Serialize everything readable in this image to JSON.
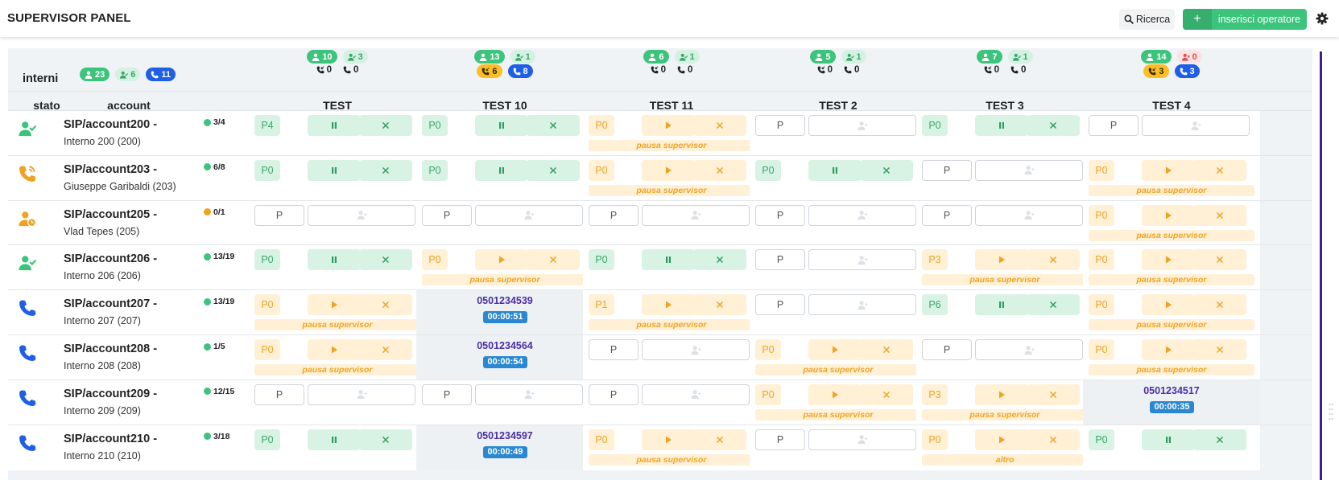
{
  "topbar": {
    "title": "SUPERVISOR PANEL",
    "search_label": "Ricerca",
    "add_label": "inserisci operatore"
  },
  "summary": {
    "label": "interni",
    "badges": [
      {
        "kind": "g",
        "icon": "user",
        "value": "23"
      },
      {
        "kind": "lg",
        "icon": "user-check",
        "value": "6"
      },
      {
        "kind": "bl",
        "icon": "phone",
        "value": "11"
      }
    ]
  },
  "table_headers": {
    "stato": "stato",
    "account": "account"
  },
  "columns": [
    {
      "name": "TEST",
      "top": [
        {
          "kind": "g",
          "icon": "user",
          "value": "10"
        },
        {
          "kind": "lg",
          "icon": "user-check",
          "value": "3"
        }
      ],
      "phones": {
        "type": "plain",
        "in": "0",
        "out": "0"
      }
    },
    {
      "name": "TEST 10",
      "top": [
        {
          "kind": "g",
          "icon": "user",
          "value": "13"
        },
        {
          "kind": "lg",
          "icon": "user-check",
          "value": "1"
        }
      ],
      "phones": {
        "type": "badges",
        "in": "6",
        "out": "8"
      }
    },
    {
      "name": "TEST 11",
      "top": [
        {
          "kind": "g",
          "icon": "user",
          "value": "6"
        },
        {
          "kind": "lg",
          "icon": "user-check",
          "value": "1"
        }
      ],
      "phones": {
        "type": "plain",
        "in": "0",
        "out": "0"
      }
    },
    {
      "name": "TEST 2",
      "top": [
        {
          "kind": "g",
          "icon": "user",
          "value": "5"
        },
        {
          "kind": "lg",
          "icon": "user-check",
          "value": "1"
        }
      ],
      "phones": {
        "type": "plain",
        "in": "0",
        "out": "0"
      }
    },
    {
      "name": "TEST 3",
      "top": [
        {
          "kind": "g",
          "icon": "user",
          "value": "7"
        },
        {
          "kind": "lg",
          "icon": "user-check",
          "value": "1"
        }
      ],
      "phones": {
        "type": "plain",
        "in": "0",
        "out": "0"
      }
    },
    {
      "name": "TEST 4",
      "top": [
        {
          "kind": "g",
          "icon": "user",
          "value": "14"
        },
        {
          "kind": "r",
          "icon": "user-x",
          "value": "0"
        }
      ],
      "phones": {
        "type": "badges",
        "in": "3",
        "out": "3"
      }
    }
  ],
  "rows": [
    {
      "status": "user-check",
      "status_color": "#3cc47c",
      "name": "SIP/account200 -",
      "sub": "Interno 200 (200)",
      "ratio": "3/4",
      "ratio_color": "#3cc47c",
      "cells": [
        {
          "t": "active",
          "p": "P4"
        },
        {
          "t": "active",
          "p": "P0"
        },
        {
          "t": "paused",
          "p": "P0",
          "note": "pausa supervisor"
        },
        {
          "t": "empty",
          "p": "P"
        },
        {
          "t": "active",
          "p": "P0"
        },
        {
          "t": "empty",
          "p": "P"
        }
      ]
    },
    {
      "status": "phone-ring",
      "status_color": "#f0a323",
      "name": "SIP/account203 -",
      "sub": "Giuseppe Garibaldi (203)",
      "ratio": "6/8",
      "ratio_color": "#3cc47c",
      "cells": [
        {
          "t": "active",
          "p": "P0"
        },
        {
          "t": "active",
          "p": "P0"
        },
        {
          "t": "paused",
          "p": "P0",
          "note": "pausa supervisor"
        },
        {
          "t": "active",
          "p": "P0"
        },
        {
          "t": "empty",
          "p": "P"
        },
        {
          "t": "paused",
          "p": "P0",
          "note": "pausa supervisor"
        }
      ]
    },
    {
      "status": "user-clock",
      "status_color": "#f0a323",
      "name": "SIP/account205 -",
      "sub": "Vlad Tepes (205)",
      "ratio": "0/1",
      "ratio_color": "#f0a323",
      "cells": [
        {
          "t": "empty",
          "p": "P"
        },
        {
          "t": "empty",
          "p": "P"
        },
        {
          "t": "empty",
          "p": "P"
        },
        {
          "t": "empty",
          "p": "P"
        },
        {
          "t": "empty",
          "p": "P"
        },
        {
          "t": "paused",
          "p": "P0",
          "note": "pausa supervisor"
        }
      ]
    },
    {
      "status": "user-check",
      "status_color": "#3cc47c",
      "name": "SIP/account206 -",
      "sub": "Interno 206 (206)",
      "ratio": "13/19",
      "ratio_color": "#3cc47c",
      "cells": [
        {
          "t": "active",
          "p": "P0"
        },
        {
          "t": "paused",
          "p": "P0",
          "note": "pausa supervisor"
        },
        {
          "t": "active",
          "p": "P0"
        },
        {
          "t": "empty",
          "p": "P"
        },
        {
          "t": "paused",
          "p": "P3",
          "note": "pausa supervisor"
        },
        {
          "t": "paused",
          "p": "P0",
          "note": "pausa supervisor"
        }
      ]
    },
    {
      "status": "phone",
      "status_color": "#1f5ee6",
      "name": "SIP/account207 -",
      "sub": "Interno 207 (207)",
      "ratio": "13/19",
      "ratio_color": "#3cc47c",
      "cells": [
        {
          "t": "paused",
          "p": "P0",
          "note": "pausa supervisor"
        },
        {
          "t": "call",
          "num": "0501234539",
          "time": "00:00:51"
        },
        {
          "t": "paused",
          "p": "P1",
          "note": "pausa supervisor"
        },
        {
          "t": "empty",
          "p": "P"
        },
        {
          "t": "active",
          "p": "P6"
        },
        {
          "t": "paused",
          "p": "P0",
          "note": "pausa supervisor"
        }
      ]
    },
    {
      "status": "phone",
      "status_color": "#1f5ee6",
      "name": "SIP/account208 -",
      "sub": "Interno 208 (208)",
      "ratio": "1/5",
      "ratio_color": "#3cc47c",
      "cells": [
        {
          "t": "paused",
          "p": "P0",
          "note": "pausa supervisor"
        },
        {
          "t": "call",
          "num": "0501234564",
          "time": "00:00:54"
        },
        {
          "t": "empty",
          "p": "P"
        },
        {
          "t": "paused",
          "p": "P0",
          "note": "pausa supervisor"
        },
        {
          "t": "empty",
          "p": "P"
        },
        {
          "t": "paused",
          "p": "P0",
          "note": "pausa supervisor"
        }
      ]
    },
    {
      "status": "phone",
      "status_color": "#1f5ee6",
      "name": "SIP/account209 -",
      "sub": "Interno 209 (209)",
      "ratio": "12/15",
      "ratio_color": "#3cc47c",
      "cells": [
        {
          "t": "empty",
          "p": "P"
        },
        {
          "t": "empty",
          "p": "P"
        },
        {
          "t": "empty",
          "p": "P"
        },
        {
          "t": "paused",
          "p": "P0",
          "note": "pausa supervisor"
        },
        {
          "t": "paused",
          "p": "P3",
          "note": "pausa supervisor"
        },
        {
          "t": "call",
          "num": "0501234517",
          "time": "00:00:35"
        }
      ]
    },
    {
      "status": "phone",
      "status_color": "#1f5ee6",
      "name": "SIP/account210 -",
      "sub": "Interno 210 (210)",
      "ratio": "3/18",
      "ratio_color": "#3cc47c",
      "cells": [
        {
          "t": "active",
          "p": "P0"
        },
        {
          "t": "call",
          "num": "0501234597",
          "time": "00:00:49"
        },
        {
          "t": "paused",
          "p": "P0",
          "note": "pausa supervisor"
        },
        {
          "t": "empty",
          "p": "P"
        },
        {
          "t": "paused",
          "p": "P0",
          "note": "altro"
        },
        {
          "t": "active",
          "p": "P0"
        }
      ]
    }
  ]
}
